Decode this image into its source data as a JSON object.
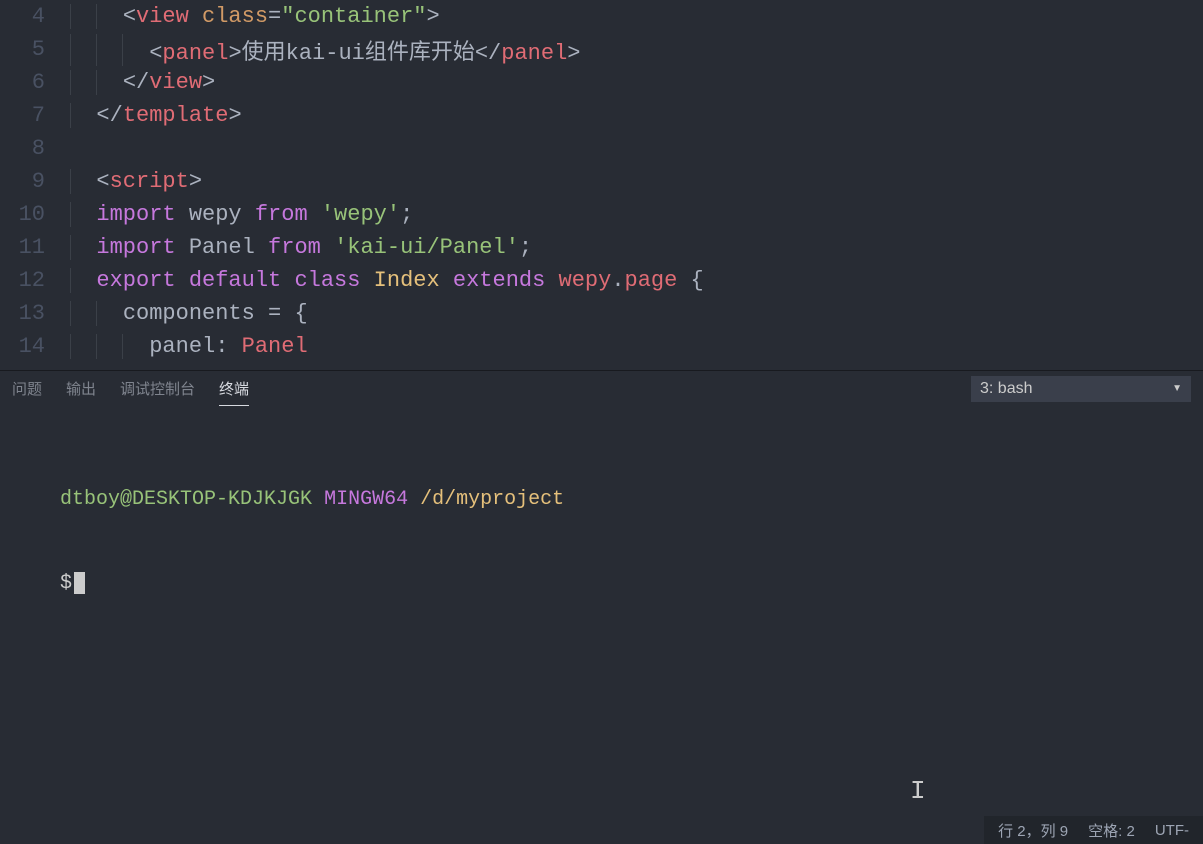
{
  "editor": {
    "lines": [
      {
        "num": "4",
        "indent": 2,
        "tokens": [
          [
            "br",
            "<"
          ],
          [
            "tag",
            "view"
          ],
          [
            "br",
            " "
          ],
          [
            "attr",
            "class"
          ],
          [
            "br",
            "="
          ],
          [
            "str",
            "\"container\""
          ],
          [
            "br",
            ">"
          ]
        ]
      },
      {
        "num": "5",
        "indent": 3,
        "tokens": [
          [
            "br",
            "<"
          ],
          [
            "tag",
            "panel"
          ],
          [
            "br",
            ">"
          ],
          [
            "id",
            "使用kai-ui组件库开始"
          ],
          [
            "br",
            "</"
          ],
          [
            "tag",
            "panel"
          ],
          [
            "br",
            ">"
          ]
        ]
      },
      {
        "num": "6",
        "indent": 2,
        "tokens": [
          [
            "br",
            "</"
          ],
          [
            "tag",
            "view"
          ],
          [
            "br",
            ">"
          ]
        ]
      },
      {
        "num": "7",
        "indent": 1,
        "tokens": [
          [
            "br",
            "</"
          ],
          [
            "tag",
            "template"
          ],
          [
            "br",
            ">"
          ]
        ]
      },
      {
        "num": "8",
        "indent": 0,
        "tokens": []
      },
      {
        "num": "9",
        "indent": 1,
        "tokens": [
          [
            "br",
            "<"
          ],
          [
            "tag",
            "script"
          ],
          [
            "br",
            ">"
          ]
        ]
      },
      {
        "num": "10",
        "indent": 1,
        "tokens": [
          [
            "kw",
            "import"
          ],
          [
            "id",
            " wepy "
          ],
          [
            "kw",
            "from"
          ],
          [
            "id",
            " "
          ],
          [
            "str",
            "'wepy'"
          ],
          [
            "id",
            ";"
          ]
        ]
      },
      {
        "num": "11",
        "indent": 1,
        "tokens": [
          [
            "kw",
            "import"
          ],
          [
            "id",
            " Panel "
          ],
          [
            "kw",
            "from"
          ],
          [
            "id",
            " "
          ],
          [
            "str",
            "'kai-ui/Panel'"
          ],
          [
            "id",
            ";"
          ]
        ]
      },
      {
        "num": "12",
        "indent": 1,
        "tokens": [
          [
            "kw",
            "export"
          ],
          [
            "id",
            " "
          ],
          [
            "kw",
            "default"
          ],
          [
            "id",
            " "
          ],
          [
            "kw",
            "class"
          ],
          [
            "id",
            " "
          ],
          [
            "cls",
            "Index"
          ],
          [
            "id",
            " "
          ],
          [
            "kw",
            "extends"
          ],
          [
            "id",
            " "
          ],
          [
            "var",
            "wepy"
          ],
          [
            "id",
            "."
          ],
          [
            "var",
            "page"
          ],
          [
            "id",
            " {"
          ]
        ]
      },
      {
        "num": "13",
        "indent": 2,
        "tokens": [
          [
            "id",
            "components "
          ],
          [
            "br",
            "="
          ],
          [
            "id",
            " {"
          ]
        ]
      },
      {
        "num": "14",
        "indent": 3,
        "tokens": [
          [
            "id",
            "panel"
          ],
          [
            "br",
            ":"
          ],
          [
            "id",
            " "
          ],
          [
            "var",
            "Panel"
          ]
        ]
      }
    ]
  },
  "panel": {
    "tabs": [
      {
        "label": "问题",
        "active": false
      },
      {
        "label": "输出",
        "active": false
      },
      {
        "label": "调试控制台",
        "active": false
      },
      {
        "label": "终端",
        "active": true
      }
    ],
    "terminalSelect": "3: bash"
  },
  "terminal": {
    "user": "dtboy@DESKTOP-KDJKJGK",
    "env": "MINGW64",
    "path": "/d/myproject",
    "prompt": "$"
  },
  "status": {
    "pos": "行 2，列 9",
    "indent": "空格: 2",
    "enc": "UTF-"
  }
}
